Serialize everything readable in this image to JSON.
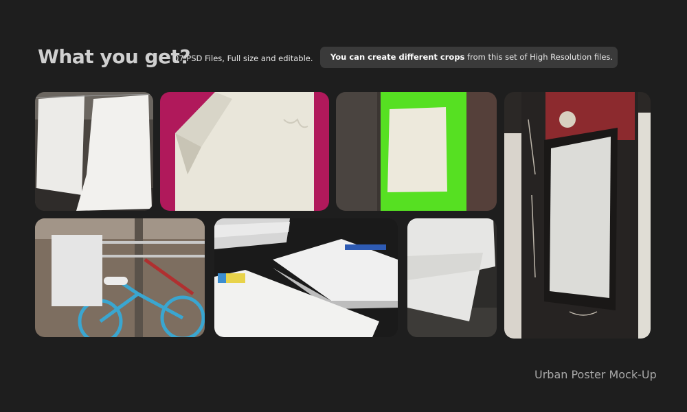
{
  "header": {
    "title": "What you get?",
    "subtitle": "07  PSD Files, Full size and editable.",
    "pill_bold": "You can create different crops",
    "pill_rest": " from this set of High Resolution files."
  },
  "footer": {
    "label": "Urban Poster Mock-Up"
  },
  "tiles": [
    {
      "name": "hanging-posters"
    },
    {
      "name": "peeling-poster-magenta"
    },
    {
      "name": "poster-on-green-wall"
    },
    {
      "name": "graffiti-doorway-poster"
    },
    {
      "name": "poster-bicycle-rack"
    },
    {
      "name": "stacked-prints"
    },
    {
      "name": "torn-poster-wall"
    }
  ]
}
